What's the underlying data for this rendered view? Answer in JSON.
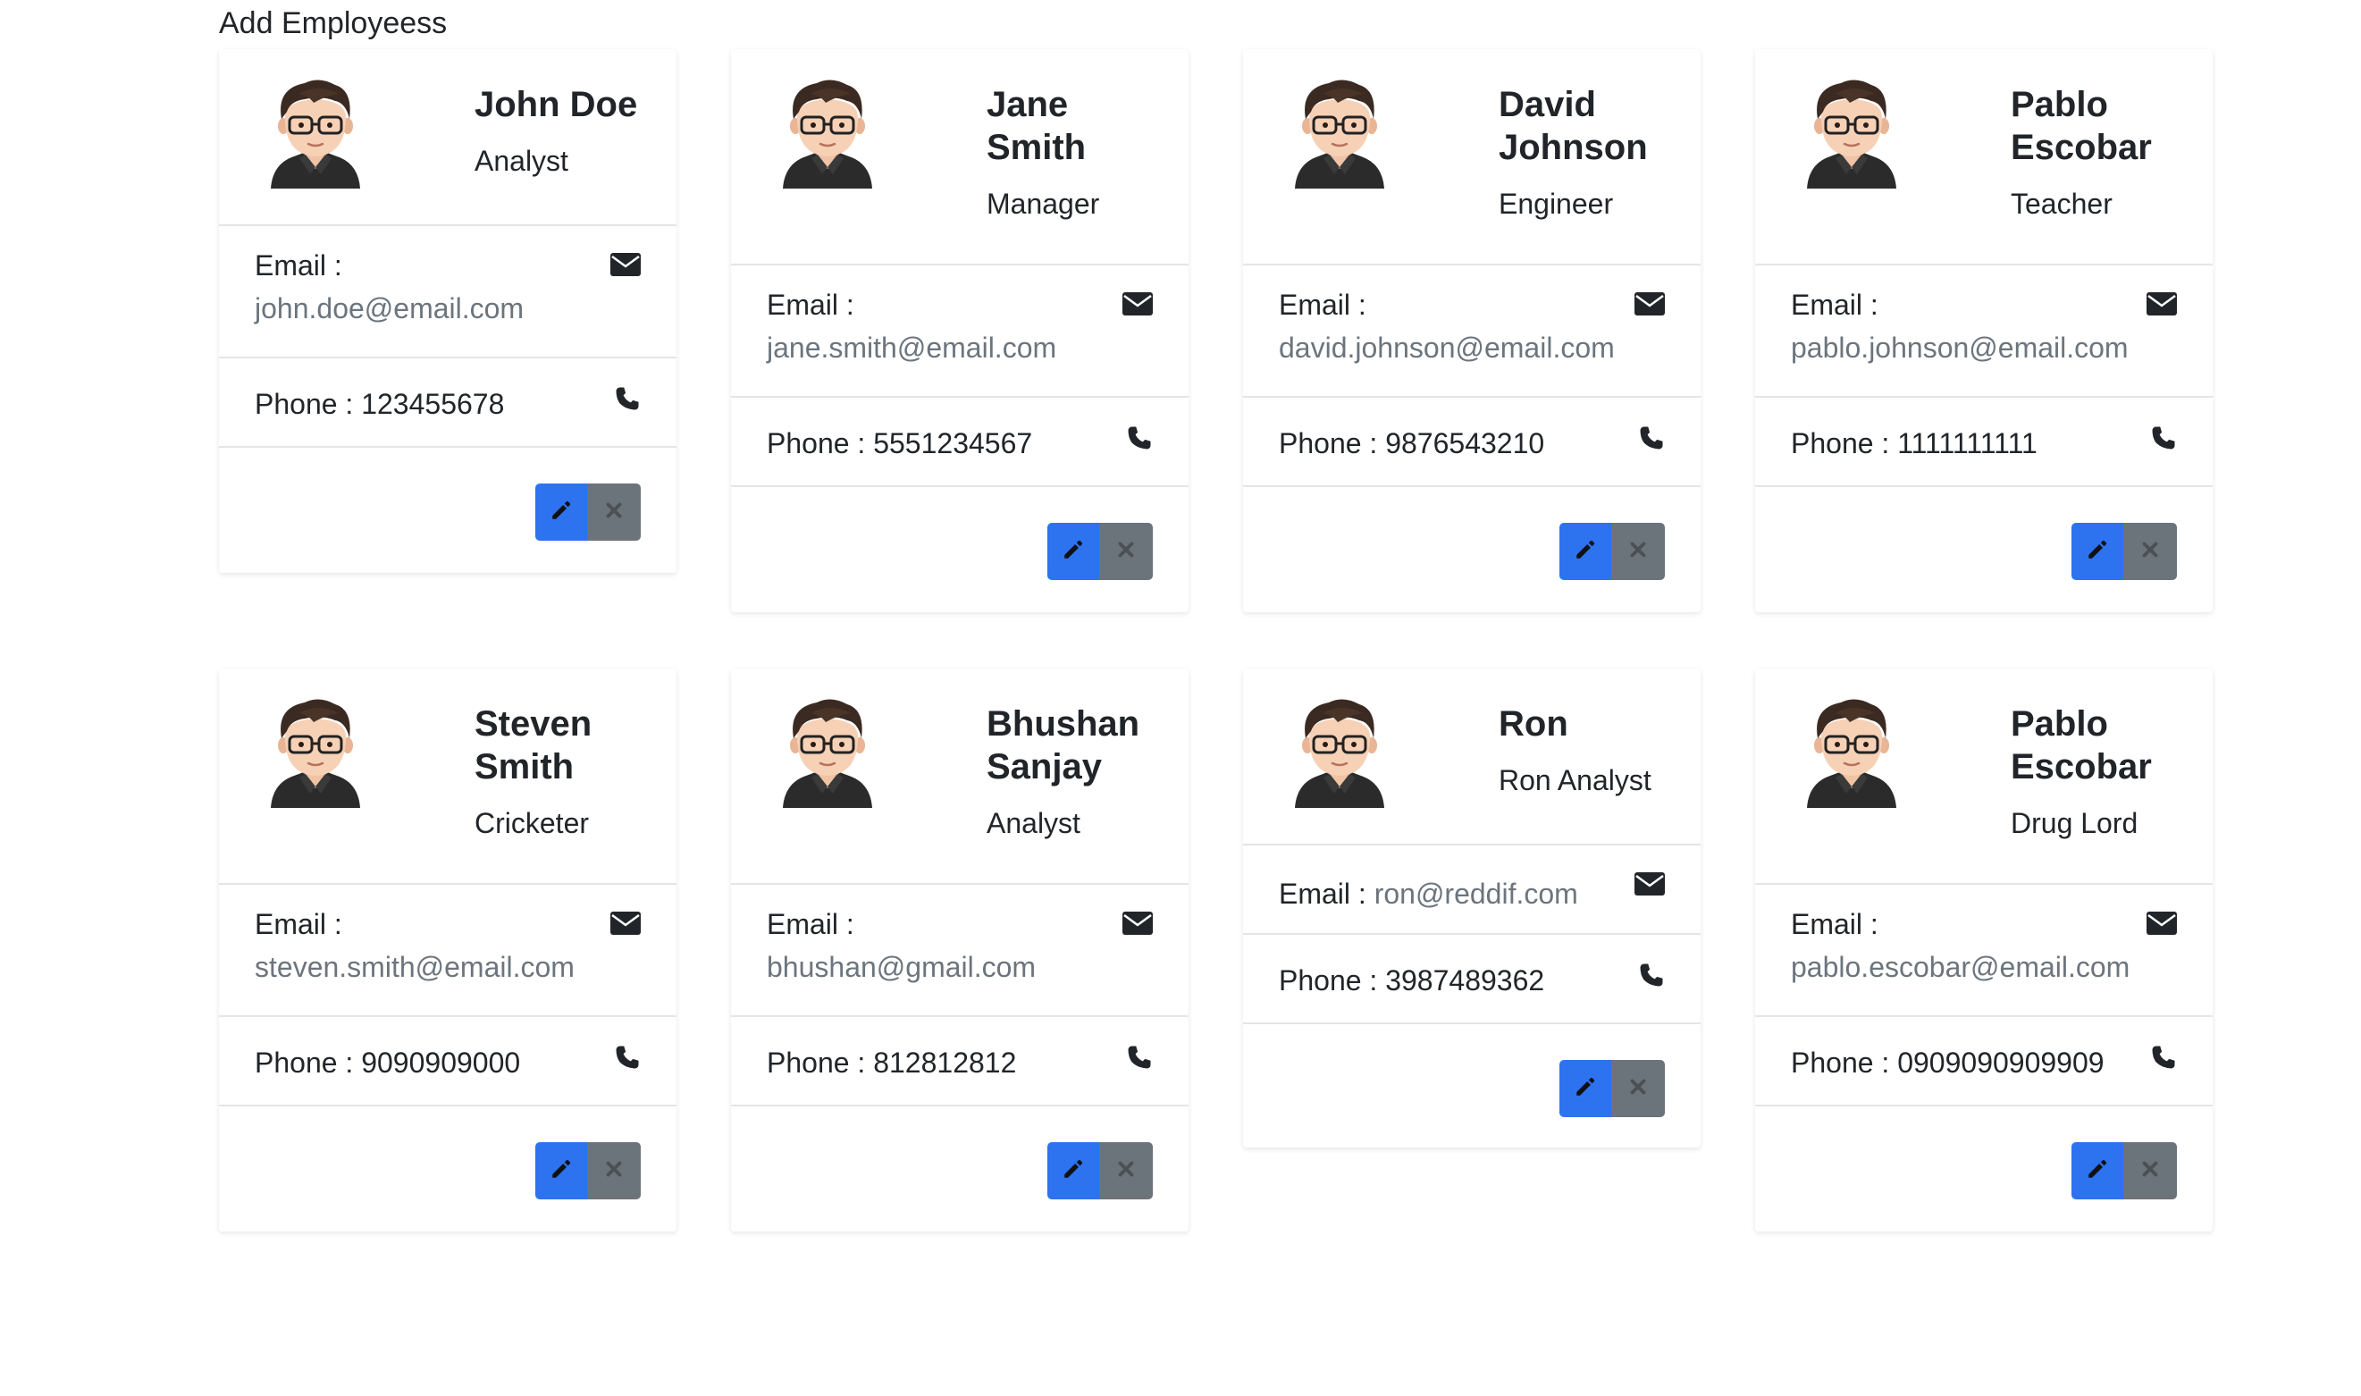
{
  "header": {
    "add_link": "Add Employeess"
  },
  "labels": {
    "email": "Email :",
    "phone": "Phone :"
  },
  "icons": {
    "avatar": "user-avatar",
    "email": "envelope-icon",
    "phone": "phone-icon",
    "edit": "pencil-icon",
    "delete": "close-icon"
  },
  "colors": {
    "edit_button": "#2d72ef",
    "delete_button": "#6b737b"
  },
  "employees": [
    {
      "name": "John Doe",
      "role": "Analyst",
      "email": "john.doe@email.com",
      "phone": "123455678"
    },
    {
      "name": "Jane Smith",
      "role": "Manager",
      "email": "jane.smith@email.com",
      "phone": "5551234567"
    },
    {
      "name": "David Johnson",
      "role": "Engineer",
      "email": "david.johnson@email.com",
      "phone": "9876543210"
    },
    {
      "name": "Pablo Escobar",
      "role": "Teacher",
      "email": "pablo.johnson@email.com",
      "phone": "1111111111"
    },
    {
      "name": "Steven Smith",
      "role": "Cricketer",
      "email": "steven.smith@email.com",
      "phone": "9090909000"
    },
    {
      "name": "Bhushan Sanjay",
      "role": "Analyst",
      "email": "bhushan@gmail.com",
      "phone": "812812812"
    },
    {
      "name": "Ron",
      "role": "Ron Analyst",
      "email": "ron@reddif.com",
      "phone": "3987489362"
    },
    {
      "name": "Pablo Escobar",
      "role": "Drug Lord",
      "email": "pablo.escobar@email.com",
      "phone": "0909090909909"
    }
  ]
}
